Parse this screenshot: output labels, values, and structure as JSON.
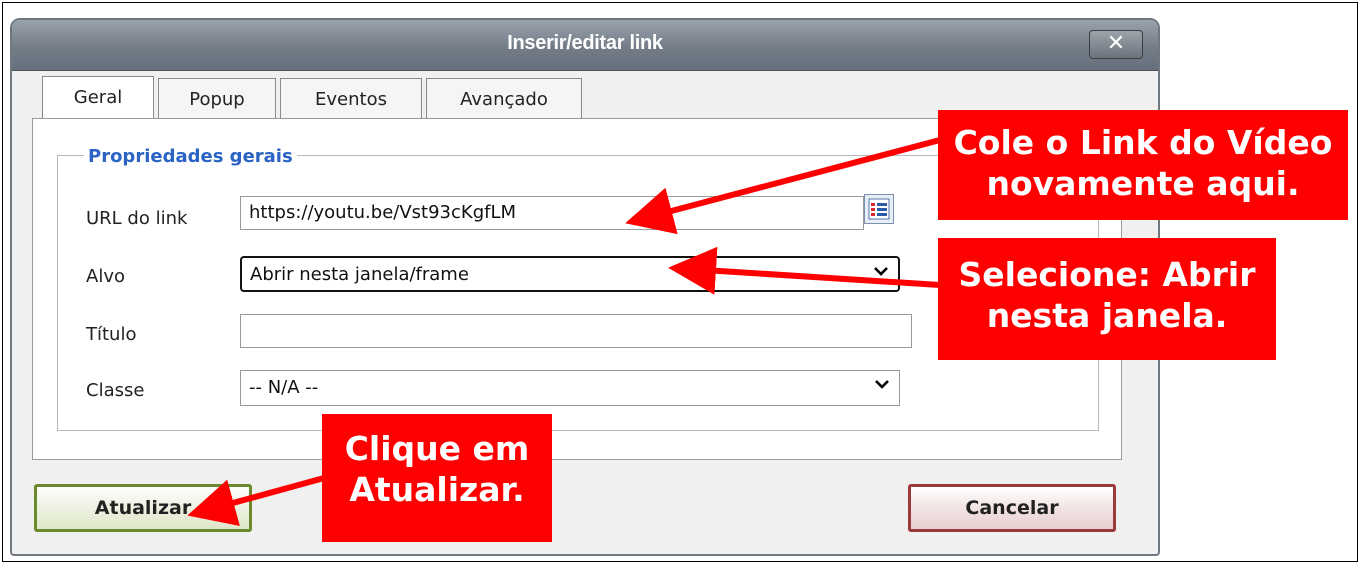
{
  "dialog": {
    "title": "Inserir/editar link",
    "close_symbol": "✕",
    "tabs": [
      {
        "label": "Geral",
        "active": true
      },
      {
        "label": "Popup",
        "active": false
      },
      {
        "label": "Eventos",
        "active": false
      },
      {
        "label": "Avançado",
        "active": false
      }
    ],
    "section_title": "Propriedades gerais",
    "fields": {
      "url": {
        "label": "URL do link",
        "value": "https://youtu.be/Vst93cKgfLM",
        "browse_icon": "browse-list-icon"
      },
      "target": {
        "label": "Alvo",
        "value": "Abrir nesta janela/frame"
      },
      "title": {
        "label": "Título",
        "value": ""
      },
      "class": {
        "label": "Classe",
        "value": "-- N/A --"
      }
    },
    "buttons": {
      "update": "Atualizar",
      "cancel": "Cancelar"
    }
  },
  "annotations": {
    "callout_1": [
      "Cole o Link do Vídeo",
      "novamente aqui."
    ],
    "callout_2": [
      "Selecione: Abrir",
      "nesta janela."
    ],
    "callout_3": [
      "Clique em",
      "Atualizar."
    ],
    "color": "#ff0000"
  }
}
